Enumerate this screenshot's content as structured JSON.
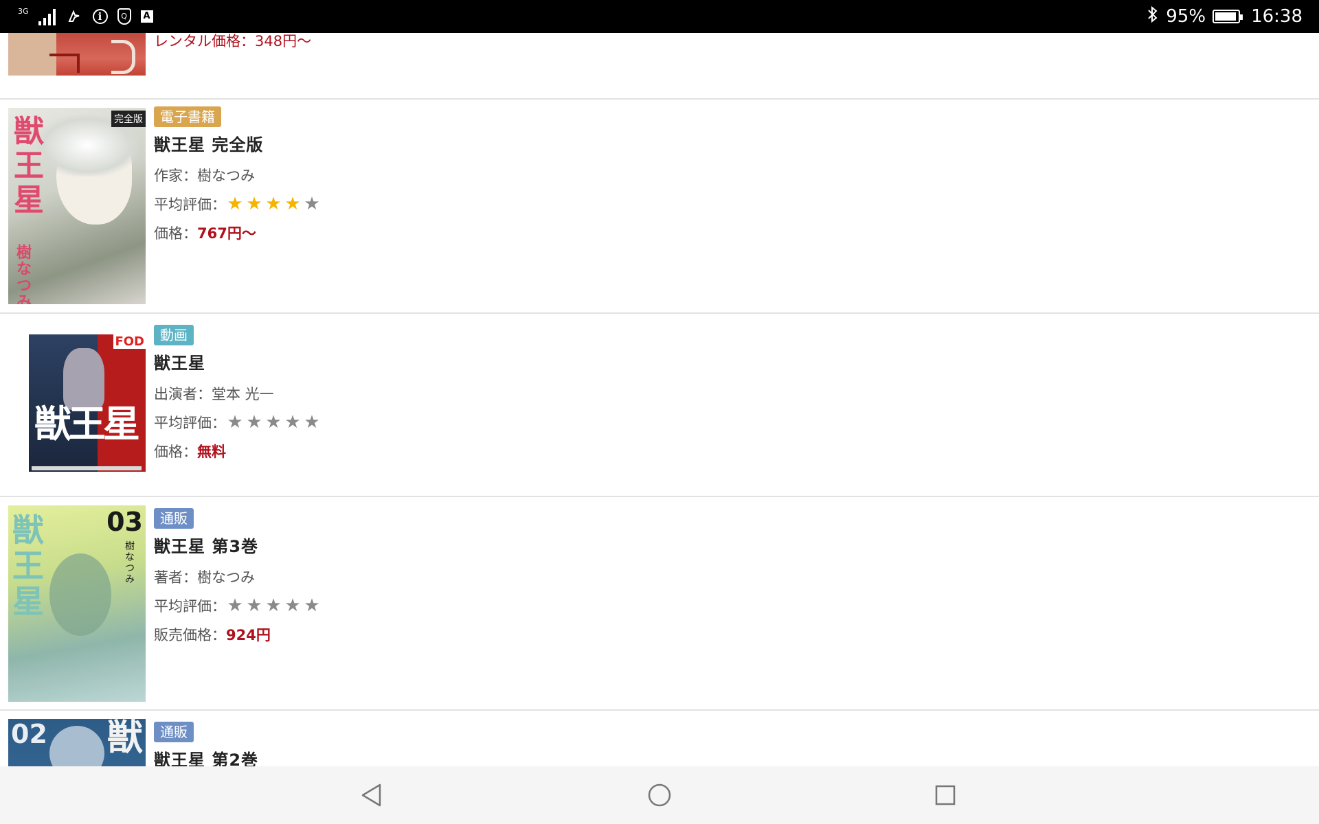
{
  "status_bar": {
    "network": "3G",
    "battery": "95%",
    "battery_level": 0.95,
    "time": "16:38",
    "icons": [
      "signal-icon",
      "cast-icon",
      "info-icon",
      "shield-icon",
      "a-icon",
      "bluetooth-icon",
      "battery-icon"
    ]
  },
  "items": [
    {
      "partial": true,
      "price_line": "レンタル価格：348円〜"
    },
    {
      "badge": "電子書籍",
      "badge_color": "#d9a54e",
      "title": "獣王星 完全版",
      "credit_label": "作家：",
      "credit": "樹なつみ",
      "rating_label": "平均評価：",
      "rating": 4,
      "price_label": "価格：",
      "price": "767円〜"
    },
    {
      "badge": "動画",
      "badge_color": "#5bb3c4",
      "title": "獣王星",
      "credit_label": "出演者：",
      "credit": "堂本 光一",
      "rating_label": "平均評価：",
      "rating": 0,
      "price_label": "価格：",
      "price": "無料",
      "thumb_logo": "FOD"
    },
    {
      "badge": "通販",
      "badge_color": "#6d8fc6",
      "title": "獣王星 第3巻",
      "credit_label": "著者：",
      "credit": "樹なつみ",
      "rating_label": "平均評価：",
      "rating": 0,
      "price_label": "販売価格：",
      "price": "924円",
      "thumb_number": "03"
    },
    {
      "badge": "通販",
      "badge_color": "#6d8fc6",
      "title": "獣王星 第2巻",
      "thumb_number": "02"
    }
  ],
  "nav": {
    "back": "back-icon",
    "home": "home-icon",
    "recents": "recents-icon"
  }
}
